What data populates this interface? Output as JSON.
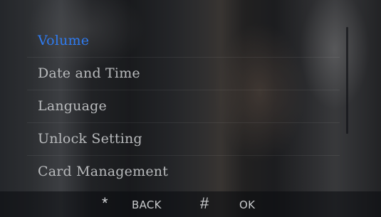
{
  "menu": {
    "items": [
      {
        "label": "Volume",
        "selected": true
      },
      {
        "label": "Date and Time",
        "selected": false
      },
      {
        "label": "Language",
        "selected": false
      },
      {
        "label": "Unlock Setting",
        "selected": false
      },
      {
        "label": "Card Management",
        "selected": false
      }
    ]
  },
  "footer": {
    "back_key": "*",
    "back_label": "BACK",
    "ok_key": "#",
    "ok_label": "OK"
  },
  "colors": {
    "selected_text": "#2f7bf0",
    "normal_text": "#b9bbbd"
  }
}
